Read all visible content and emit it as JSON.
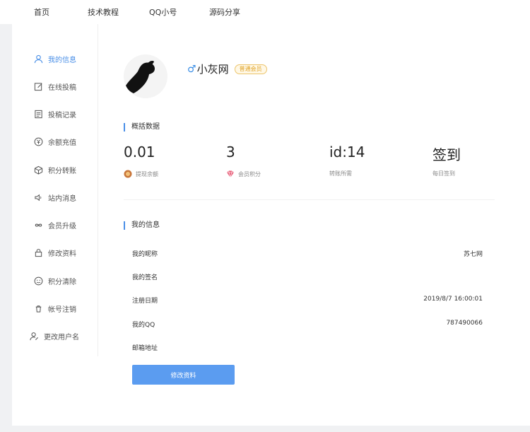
{
  "topnav": {
    "items": [
      {
        "label": "首页"
      },
      {
        "label": "技术教程"
      },
      {
        "label": "QQ小号"
      },
      {
        "label": "源码分享"
      }
    ]
  },
  "sidebar": {
    "items": [
      {
        "label": "我的信息",
        "icon": "user-icon"
      },
      {
        "label": "在线投稿",
        "icon": "edit-icon"
      },
      {
        "label": "投稿记录",
        "icon": "document-icon"
      },
      {
        "label": "余额充值",
        "icon": "yen-icon"
      },
      {
        "label": "积分转账",
        "icon": "cube-icon"
      },
      {
        "label": "站内消息",
        "icon": "speaker-icon"
      },
      {
        "label": "会员升级",
        "icon": "infinity-icon"
      },
      {
        "label": "修改资料",
        "icon": "lock-icon"
      },
      {
        "label": "积分清除",
        "icon": "smile-icon"
      },
      {
        "label": "帐号注销",
        "icon": "trash-icon"
      },
      {
        "label": "更改用户名",
        "icon": "user-edit-icon"
      }
    ],
    "active_color": "#4a8fe7"
  },
  "profile": {
    "gender_symbol": "♂",
    "username": "小灰网",
    "badge": "普通会员"
  },
  "overview": {
    "title": "概括数据",
    "stats": [
      {
        "value": "0.01",
        "label": "提现余额",
        "icon": "wallet-icon"
      },
      {
        "value": "3",
        "label": "会员积分",
        "icon": "diamond-icon"
      },
      {
        "value": "id:14",
        "label": "转账所需",
        "icon": ""
      },
      {
        "value": "签到",
        "label": "每日签到",
        "icon": ""
      }
    ]
  },
  "myinfo": {
    "title": "我的信息",
    "rows": [
      {
        "label": "我的昵称",
        "value": "苏七网"
      },
      {
        "label": "我的签名",
        "value": ""
      },
      {
        "label": "注册日期",
        "value": "2019/8/7 16:00:01"
      },
      {
        "label": "我的QQ",
        "value": "787490066"
      },
      {
        "label": "邮箱地址",
        "value": ""
      }
    ],
    "button_label": "修改资料"
  },
  "colors": {
    "accent": "#4a8fe7",
    "button": "#5b9cf0",
    "badge": "#e0a42a"
  }
}
